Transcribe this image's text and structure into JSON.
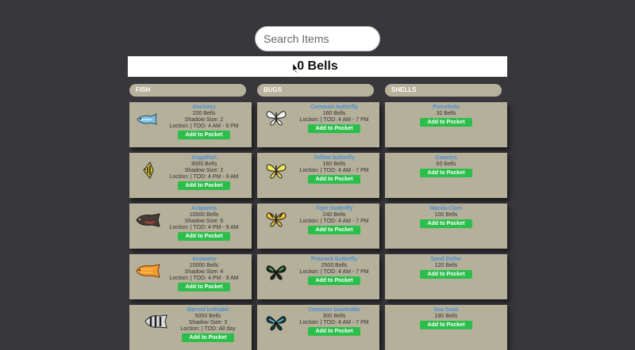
{
  "search": {
    "placeholder": "Search Items"
  },
  "pocket": {
    "total": "0 Bells"
  },
  "columns": {
    "fish": {
      "title": "FISH",
      "items": [
        {
          "name": "Anchovy",
          "price": "200 Bells",
          "shadow": "Shadow Size: 2",
          "location": "Loction: | TOD: 4 AM - 9 PM",
          "icon": "anchovy-icon"
        },
        {
          "name": "Angelfish",
          "price": "3000 Bells",
          "shadow": "Shadow Size: 2",
          "location": "Loction: | TOD: 4 PM - 9 AM",
          "icon": "angelfish-icon"
        },
        {
          "name": "Arapaima",
          "price": "10000 Bells",
          "shadow": "Shadow Size: 6",
          "location": "Loction: | TOD: 4 PM - 9 AM",
          "icon": "arapaima-icon"
        },
        {
          "name": "Arowana",
          "price": "10000 Bells",
          "shadow": "Shadow Size: 4",
          "location": "Loction: | TOD: 4 PM - 9 AM",
          "icon": "arowana-icon"
        },
        {
          "name": "Barred knifejaw",
          "price": "5000 Bells",
          "shadow": "Shadow Size: 3",
          "location": "Loction: | TOD: All day",
          "icon": "barred-knifejaw-icon"
        }
      ]
    },
    "bugs": {
      "title": "BUGS",
      "items": [
        {
          "name": "Common butterfly",
          "price": "160 Bells",
          "location": "Loction: | TOD: 4 AM - 7 PM",
          "icon": "common-butterfly-icon"
        },
        {
          "name": "Yellow butterfly",
          "price": "160 Bells",
          "location": "Loction: | TOD: 4 AM - 7 PM",
          "icon": "yellow-butterfly-icon"
        },
        {
          "name": "Tiger butterfly",
          "price": "240 Bells",
          "location": "Loction: | TOD: 4 AM - 7 PM",
          "icon": "tiger-butterfly-icon"
        },
        {
          "name": "Peacock butterfly",
          "price": "2500 Bells",
          "location": "Loction: | TOD: 4 AM - 7 PM",
          "icon": "peacock-butterfly-icon"
        },
        {
          "name": "Common bluebottle",
          "price": "300 Bells",
          "location": "Loction: | TOD: 4 AM - 7 PM",
          "icon": "common-bluebottle-icon"
        }
      ]
    },
    "shells": {
      "title": "SHELLS",
      "items": [
        {
          "name": "Porceletta",
          "price": "30 Bells"
        },
        {
          "name": "Cowries",
          "price": "60 Bells"
        },
        {
          "name": "Manila Clam",
          "price": "100 Bells"
        },
        {
          "name": "Sand Dollar",
          "price": "120 Bells"
        },
        {
          "name": "Sea Snail",
          "price": "180 Bells"
        }
      ]
    }
  },
  "add_button_label": "Add to Pocket",
  "colors": {
    "background": "#38373c",
    "card": "#b5b09a",
    "header": "#b7b29c",
    "name": "#4a8fd6",
    "button": "#2bbe4b"
  }
}
